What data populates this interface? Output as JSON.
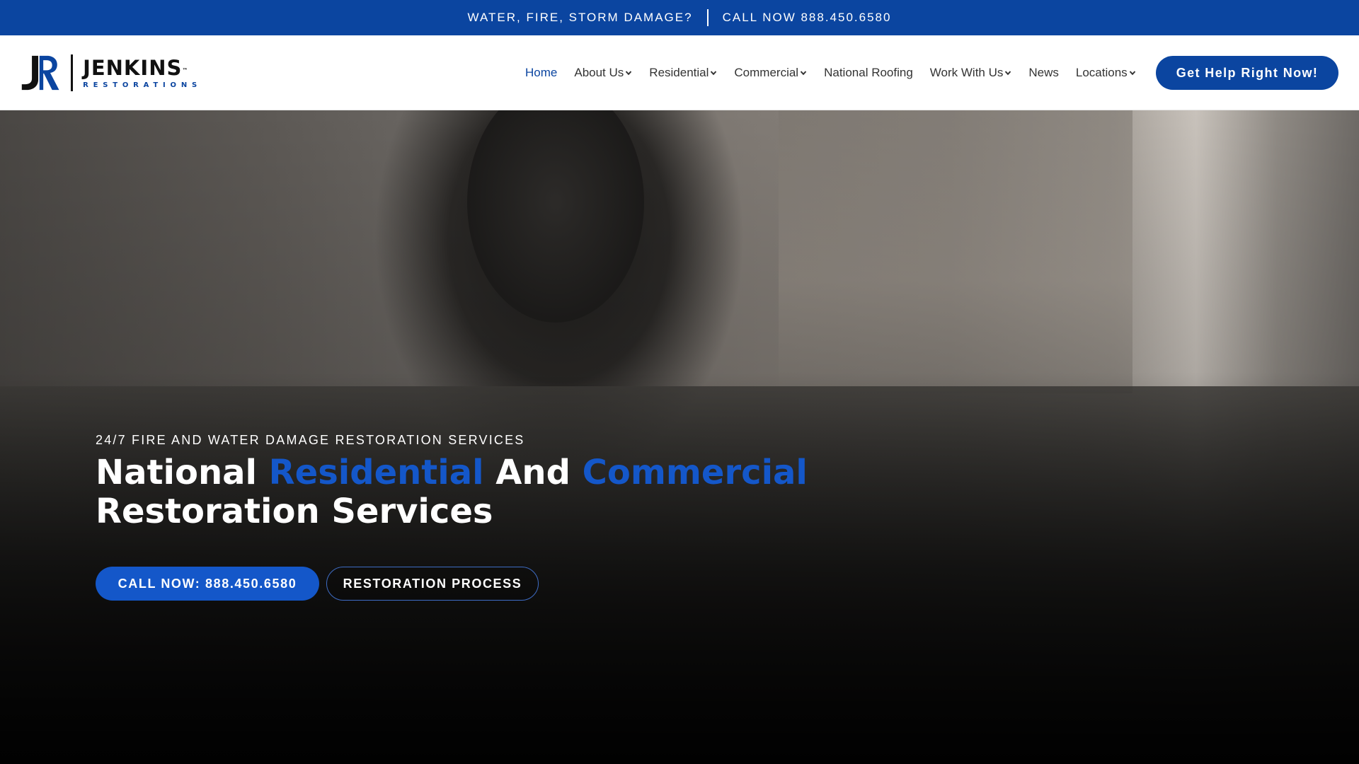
{
  "topbar": {
    "message": "WATER, FIRE, STORM DAMAGE?",
    "phone_label": "CALL NOW 888.450.6580"
  },
  "brand": {
    "name": "JENKINS",
    "trademark": "™",
    "subtitle": "RESTORATIONS",
    "monogram": "JR"
  },
  "nav": {
    "items": [
      {
        "label": "Home",
        "active": true,
        "dropdown": false
      },
      {
        "label": "About Us",
        "active": false,
        "dropdown": true
      },
      {
        "label": "Residential",
        "active": false,
        "dropdown": true
      },
      {
        "label": "Commercial",
        "active": false,
        "dropdown": true
      },
      {
        "label": "National Roofing",
        "active": false,
        "dropdown": false
      },
      {
        "label": "Work With Us",
        "active": false,
        "dropdown": true
      },
      {
        "label": "News",
        "active": false,
        "dropdown": false
      },
      {
        "label": "Locations",
        "active": false,
        "dropdown": true
      }
    ],
    "cta_label": "Get Help Right Now!"
  },
  "hero": {
    "eyebrow": "24/7 FIRE AND WATER DAMAGE RESTORATION SERVICES",
    "headline_parts": {
      "part1": "National ",
      "highlight1": "Residential",
      "part2": " And ",
      "highlight2": "Commercial",
      "part3": " Restoration Services"
    },
    "primary_button": "CALL NOW: 888.450.6580",
    "secondary_button": "RESTORATION PROCESS"
  },
  "colors": {
    "brand_blue": "#0b45a0",
    "accent_blue": "#1457c9",
    "white": "#ffffff"
  }
}
